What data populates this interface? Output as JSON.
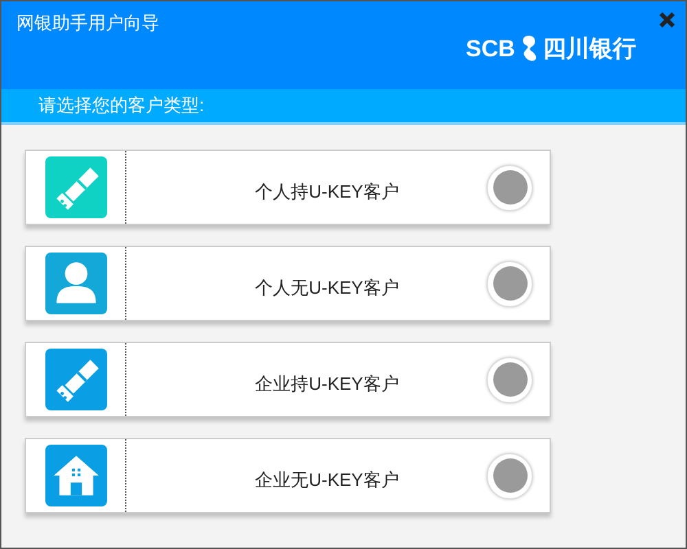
{
  "window": {
    "title": "网银助手用户向导"
  },
  "logo": {
    "latin": "SCB",
    "name": "四川银行"
  },
  "prompt": "请选择您的客户类型:",
  "options": [
    {
      "label": "个人持U-KEY客户",
      "kind": "usb",
      "color": "#0fd2c4",
      "selected": false
    },
    {
      "label": "个人无U-KEY客户",
      "kind": "person",
      "color": "#14a8d8",
      "selected": false
    },
    {
      "label": "企业持U-KEY客户",
      "kind": "usb",
      "color": "#0a9ee4",
      "selected": false
    },
    {
      "label": "企业无U-KEY客户",
      "kind": "house",
      "color": "#0a9ee4",
      "selected": false
    }
  ]
}
